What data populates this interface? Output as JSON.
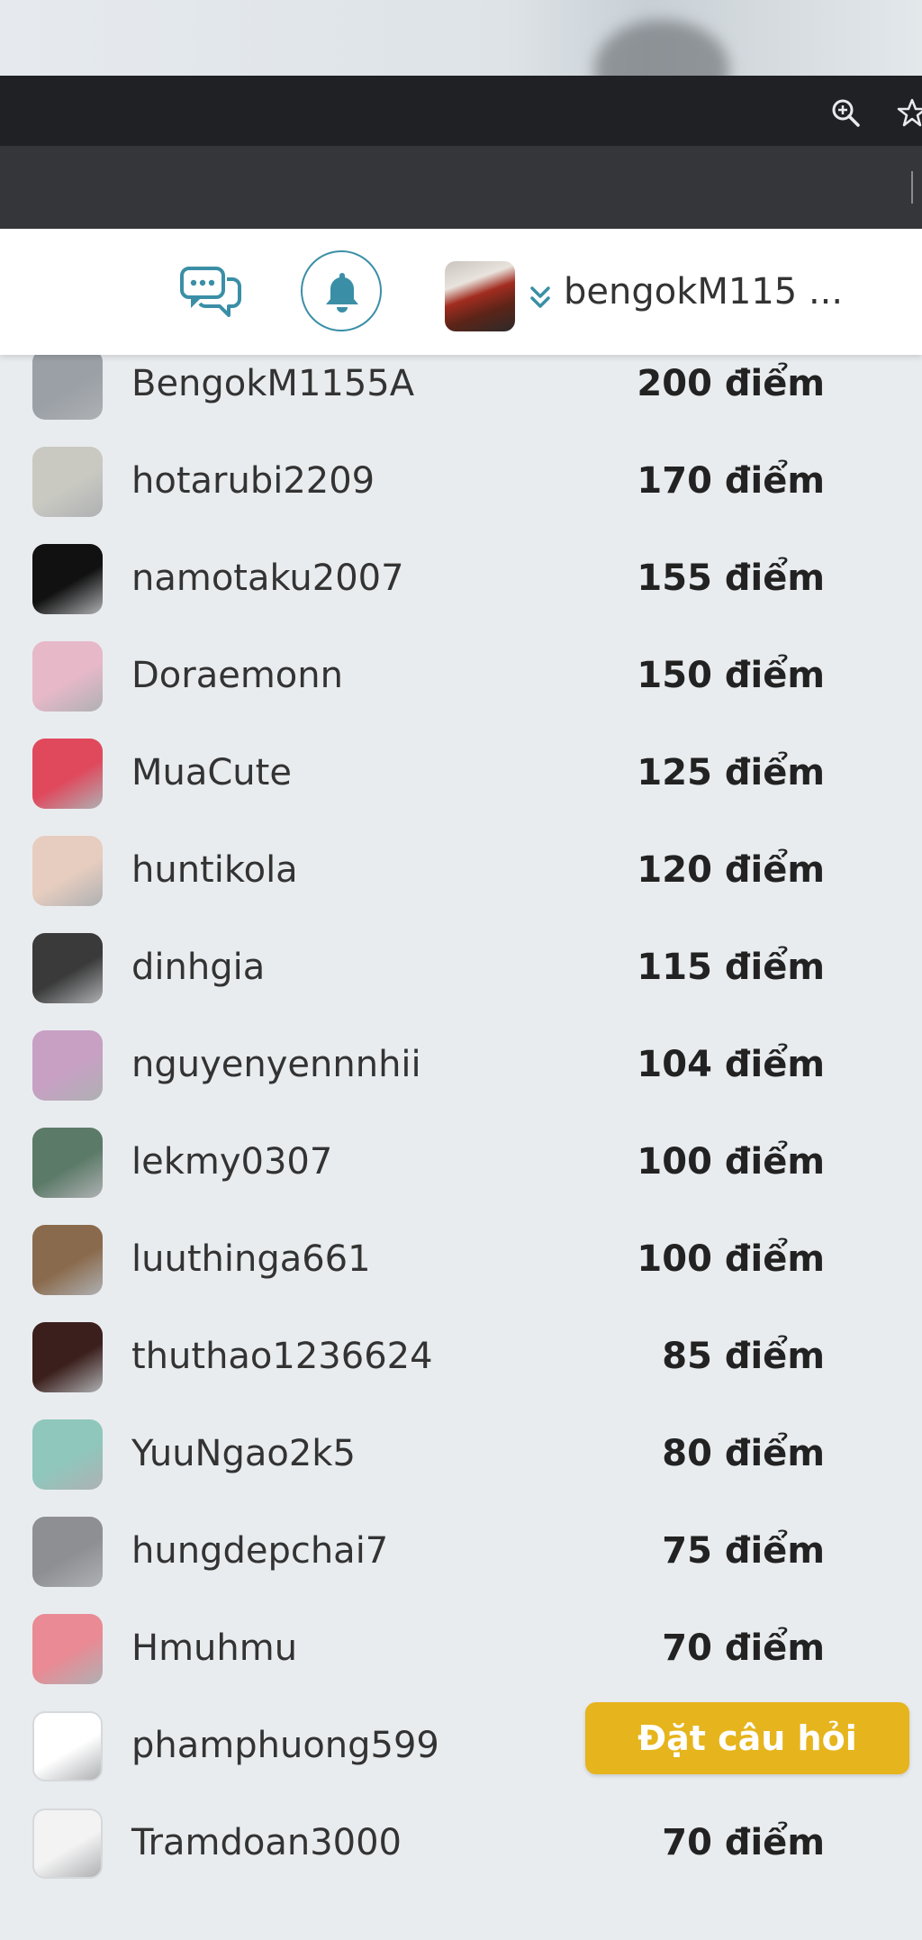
{
  "header": {
    "chat_icon": "chat-bubbles-icon",
    "bell_icon": "bell-icon",
    "user": {
      "name": "bengokM115 ..."
    }
  },
  "browser": {
    "zoom_icon": "zoom-in-icon",
    "star_icon": "star-icon"
  },
  "colors": {
    "accent": "#3a8fa6",
    "ask_button": "#e6b41c",
    "page_bg": "#e9ecef"
  },
  "leaderboard": [
    {
      "name": "BengokM1155A",
      "score": "200 điểm",
      "avatar": "#9aa0a6"
    },
    {
      "name": "hotarubi2209",
      "score": "170 điểm",
      "avatar": "#c9c9c2"
    },
    {
      "name": "namotaku2007",
      "score": "155 điểm",
      "avatar": "#111111"
    },
    {
      "name": "Doraemonn",
      "score": "150 điểm",
      "avatar": "#e6b8c8"
    },
    {
      "name": "MuaCute",
      "score": "125 điểm",
      "avatar": "#e0485c"
    },
    {
      "name": "huntikola",
      "score": "120 điểm",
      "avatar": "#e7cdbf"
    },
    {
      "name": "dinhgia",
      "score": "115 điểm",
      "avatar": "#3a3a3a"
    },
    {
      "name": "nguyenyennnhii",
      "score": "104 điểm",
      "avatar": "#c7a0c4"
    },
    {
      "name": "lekmy0307",
      "score": "100 điểm",
      "avatar": "#5c7a68"
    },
    {
      "name": "luuthinga661",
      "score": "100 điểm",
      "avatar": "#8a6a4c"
    },
    {
      "name": "thuthao1236624",
      "score": "85 điểm",
      "avatar": "#3b1f1c"
    },
    {
      "name": "YuuNgao2k5",
      "score": "80 điểm",
      "avatar": "#8fc7bd"
    },
    {
      "name": "hungdepchai7",
      "score": "75 điểm",
      "avatar": "#8d8f93"
    },
    {
      "name": "Hmuhmu",
      "score": "70 điểm",
      "avatar": "#e98a94"
    },
    {
      "name": "phamphuong599",
      "score": "",
      "avatar": "#ffffff"
    },
    {
      "name": "Tramdoan3000",
      "score": "70 điểm",
      "avatar": "#f3f3f3"
    }
  ],
  "ask_button": {
    "label": "Đặt câu hỏi"
  }
}
